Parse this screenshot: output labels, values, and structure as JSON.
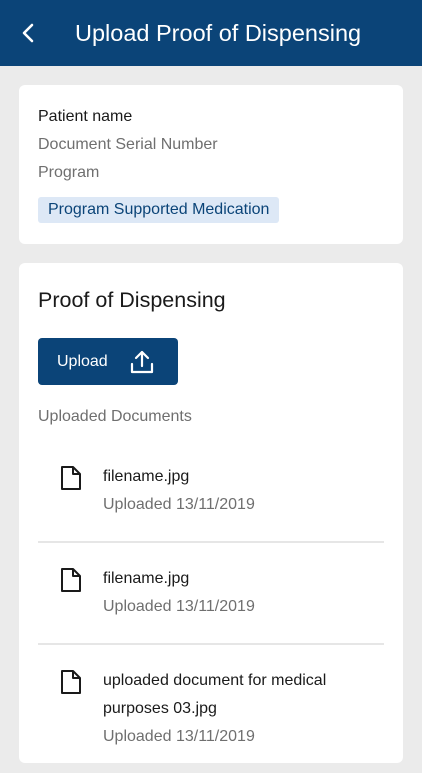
{
  "header": {
    "title": "Upload Proof of Dispensing",
    "back_icon": "chevron-left-icon"
  },
  "patient": {
    "name_label": "Patient name",
    "serial_label": "Document Serial Number",
    "program_label": "Program",
    "badge": "Program Supported Medication"
  },
  "proof": {
    "title": "Proof of Dispensing",
    "upload_label": "Upload",
    "upload_icon": "upload-icon",
    "documents_heading": "Uploaded Documents",
    "documents": [
      {
        "name": "filename.jpg",
        "date": "Uploaded 13/11/2019"
      },
      {
        "name": "filename.jpg",
        "date": "Uploaded 13/11/2019"
      },
      {
        "name": "uploaded document for medical purposes 03.jpg",
        "date": "Uploaded 13/11/2019"
      }
    ]
  },
  "colors": {
    "primary": "#0b4478",
    "badge_bg": "#dde8f6",
    "background": "#ebebeb"
  }
}
